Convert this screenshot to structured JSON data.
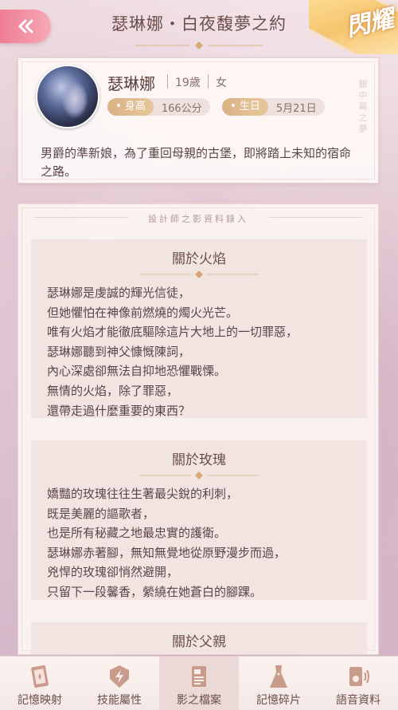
{
  "header": {
    "title": "瑟琳娜・白夜馥夢之約",
    "badge": "閃耀"
  },
  "profile": {
    "name": "瑟琳娜",
    "age": "19歲",
    "gender": "女",
    "height_label": "身高",
    "height_value": "166公分",
    "birthday_label": "生日",
    "birthday_value": "5月21日",
    "vertical_text": "鏡中幕之夢",
    "description": "男爵的準新娘，為了重回母親的古堡，即將踏上未知的宿命之路。"
  },
  "records": {
    "heading": "設計師之影資料錄入",
    "sections": [
      {
        "title": "關於火焰",
        "lines": [
          "瑟琳娜是虔誠的輝光信徒，",
          "但她懼怕在神像前燃燒的燭火光芒。",
          "唯有火焰才能徹底驅除這片大地上的一切罪惡，",
          "瑟琳娜聽到神父慷慨陳詞，",
          "內心深處卻無法自抑地恐懼戰慄。",
          "無情的火焰，除了罪惡，",
          "還帶走過什麼重要的東西？"
        ]
      },
      {
        "title": "關於玫瑰",
        "lines": [
          "嬌豔的玫瑰往往生著最尖銳的利刺，",
          "既是美麗的謳歌者，",
          "也是所有秘藏之地最忠實的護衛。",
          "瑟琳娜赤著腳，無知無覺地從原野漫步而過，",
          "兇悍的玫瑰卻悄然避開，",
          "只留下一段馨香，縈繞在她蒼白的腳踝。"
        ]
      },
      {
        "title": "關於父親",
        "lines": []
      }
    ]
  },
  "tabs": [
    {
      "label": "記憶映射",
      "icon": "memory-card-icon",
      "active": false
    },
    {
      "label": "技能屬性",
      "icon": "lightning-shield-icon",
      "active": false
    },
    {
      "label": "影之檔案",
      "icon": "document-icon",
      "active": true
    },
    {
      "label": "記憶碎片",
      "icon": "dress-icon",
      "active": false
    },
    {
      "label": "語音資料",
      "icon": "voice-device-icon",
      "active": false
    }
  ]
}
